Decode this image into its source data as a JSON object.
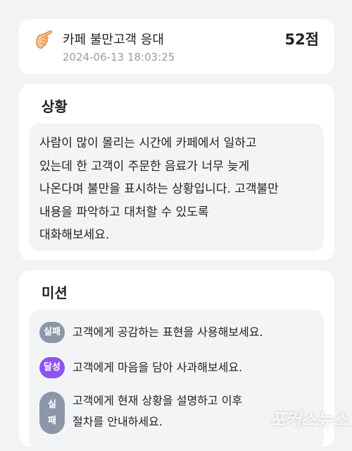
{
  "header": {
    "title": "카페 불만고객 응대",
    "datetime": "2024-06-13 18:03:25",
    "score": "52점",
    "icon": "pointing-hand-icon"
  },
  "situation": {
    "title": "상황",
    "lines": [
      "사람이 많이 몰리는 시간에 카페에서 일하고",
      "있는데 한 고객이 주문한 음료가 너무 늦게",
      "나온다며 불만을 표시하는 상황입니다. 고객불만",
      "내용을 파악하고 대처할 수 있도록",
      "대화해보세요."
    ]
  },
  "mission": {
    "title": "미션",
    "items": [
      {
        "status": "실패",
        "lines": [
          "고객에게 공감하는 표현을 사용해보세요."
        ]
      },
      {
        "status": "달성",
        "lines": [
          "고객에게 마음을 담아 사과해보세요."
        ]
      },
      {
        "status_lines": [
          "실",
          "패"
        ],
        "lines": [
          "고객에게 현재 상황을 설명하고 이후",
          "절차를 안내하세요."
        ]
      }
    ]
  },
  "colors": {
    "background": "#f2f3f5",
    "fail_badge": "#8b97a8",
    "success_badge": "#8e53f0",
    "subtle_text": "#9a9ca3"
  },
  "watermark": "포커스뉴스"
}
